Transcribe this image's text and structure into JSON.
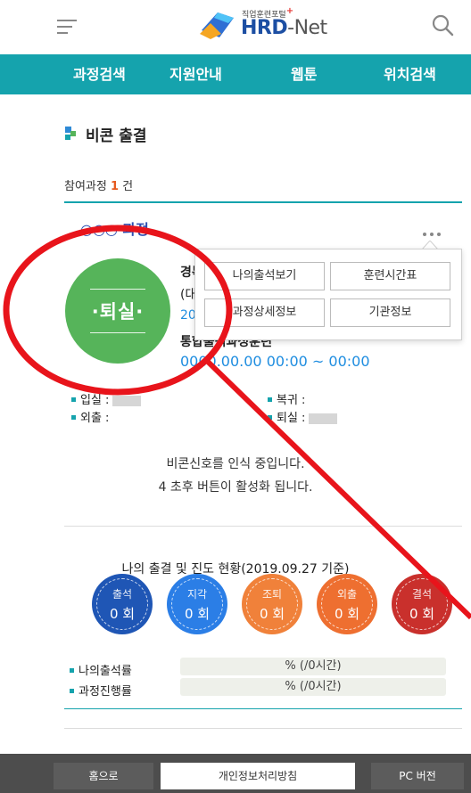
{
  "header": {
    "logo_sub": "직업훈련포털",
    "logo_plus": "+",
    "logo_main": "HRD",
    "logo_net": "-Net"
  },
  "nav": {
    "items": [
      "과정검색",
      "지원안내",
      "웹툰",
      "위치검색"
    ]
  },
  "section": {
    "title": "비콘 출결",
    "count_prefix": "참여과정",
    "count_value": "1",
    "count_suffix": "건"
  },
  "course": {
    "title": "○○○ 과정",
    "status_badge": "·퇴실·",
    "info_line1": "경복",
    "info_line2": "(대",
    "info_line3": "20",
    "period_label": "통합출석과정훈련",
    "period_value": "0000.00.00 00:00 ~ 00:00"
  },
  "popup_menu": {
    "items": [
      "나의출석보기",
      "훈련시간표",
      "과정상세정보",
      "기관정보"
    ]
  },
  "record": {
    "entry_label": "입실 :",
    "return_label": "복귀 :",
    "out_label": "외출 :",
    "exit_label": "퇴실 :"
  },
  "beacon": {
    "line1": "비콘신호를 인식 중입니다.",
    "line2": "4 초후 버튼이 활성화 됩니다."
  },
  "status": {
    "title": "나의 출결 및 진도 현황(2019.09.27 기준)",
    "circles": [
      {
        "label": "출석",
        "value": "0 회",
        "color": "#1f56b5"
      },
      {
        "label": "지각",
        "value": "0 회",
        "color": "#2b7ee6"
      },
      {
        "label": "조퇴",
        "value": "0 회",
        "color": "#f0813a"
      },
      {
        "label": "외출",
        "value": "0 회",
        "color": "#ee6f30"
      },
      {
        "label": "결석",
        "value": "0 회",
        "color": "#c9302c"
      }
    ],
    "attendance_rate_label": "나의출석률",
    "attendance_rate_value": "% (/0시간)",
    "progress_rate_label": "과정진행률",
    "progress_rate_value": "% (/0시간)"
  },
  "footer": {
    "home": "홈으로",
    "privacy": "개인정보처리방침",
    "pc": "PC 버전"
  },
  "colors": {
    "nav_bg": "#15a3ad",
    "badge_green": "#56b45a",
    "annotation_red": "#e8141b"
  }
}
